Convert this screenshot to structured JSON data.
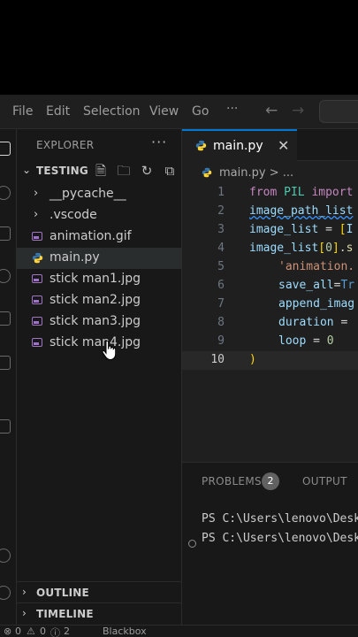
{
  "menu": [
    "File",
    "Edit",
    "Selection",
    "View",
    "Go"
  ],
  "menu_more": "···",
  "sidebar": {
    "title": "EXPLORER",
    "more": "···",
    "folder": "TESTING",
    "items": [
      {
        "label": "__pycache__",
        "kind": "folder"
      },
      {
        "label": ".vscode",
        "kind": "folder"
      },
      {
        "label": "animation.gif",
        "kind": "image"
      },
      {
        "label": "main.py",
        "kind": "python"
      },
      {
        "label": "stick man1.jpg",
        "kind": "image"
      },
      {
        "label": "stick man2.jpg",
        "kind": "image"
      },
      {
        "label": "stick man3.jpg",
        "kind": "image"
      },
      {
        "label": "stick man4.jpg",
        "kind": "image"
      }
    ],
    "outline": "OUTLINE",
    "timeline": "TIMELINE"
  },
  "editor": {
    "tab_label": "main.py",
    "breadcrumb": "main.py > ...",
    "line_numbers": [
      "1",
      "2",
      "3",
      "4",
      "5",
      "6",
      "7",
      "8",
      "9",
      "10"
    ],
    "current_line": "10"
  },
  "panel": {
    "problems_label": "PROBLEMS",
    "problems_count": "2",
    "output_label": "OUTPUT",
    "terminal_lines": [
      "PS C:\\Users\\lenovo\\Desk",
      "PS C:\\Users\\lenovo\\Desk"
    ]
  },
  "status": {
    "errors": "0",
    "warnings": "0",
    "info": "2",
    "extension": "Blackbox"
  },
  "colors": {
    "accent": "#0078d4",
    "python_blue": "#3776ab",
    "python_yellow": "#ffd43b",
    "image_icon": "#a074c4"
  }
}
